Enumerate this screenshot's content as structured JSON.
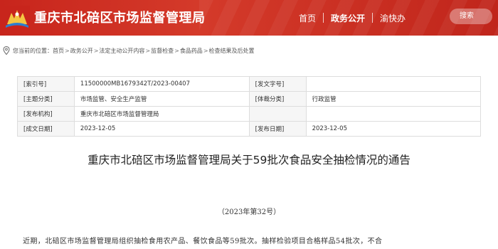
{
  "header": {
    "site_title": "重庆市北碚区市场监督管理局",
    "nav": [
      {
        "label": "首页"
      },
      {
        "label": "政务公开"
      },
      {
        "label": "渝快办"
      }
    ],
    "search_label": "搜索",
    "colors": {
      "bar": "#c8251c",
      "text": "#ffffff"
    }
  },
  "breadcrumb": {
    "prefix": "您当前的位置：",
    "items": [
      "首页",
      "政务公开",
      "法定主动公开内容",
      "监督检查",
      "食品药品",
      "检查结果及后处置"
    ],
    "separator": ">"
  },
  "info": {
    "rows": [
      {
        "l1": "[索引号]",
        "v1": "11500000MB1679342T/2023-00407",
        "l2": "[发文字号]",
        "v2": ""
      },
      {
        "l1": "[主题分类]",
        "v1": "市场监管、安全生产监管",
        "l2": "[体裁分类]",
        "v2": "行政监管"
      },
      {
        "l1": "[发布机构]",
        "v1": "重庆市北碚区市场监督管理局",
        "l2": "",
        "v2": ""
      },
      {
        "l1": "[成文日期]",
        "v1": "2023-12-05",
        "l2": "[发布日期]",
        "v2": "2023-12-05"
      }
    ]
  },
  "article": {
    "title": "重庆市北碚区市场监督管理局关于59批次食品安全抽检情况的通告",
    "doc_number": "（2023年第32号）",
    "body_first_line": "近期，北碚区市场监督管理局组织抽检食用农产品、餐饮食品等59批次。抽样检验项目合格样品54批次，不合"
  }
}
